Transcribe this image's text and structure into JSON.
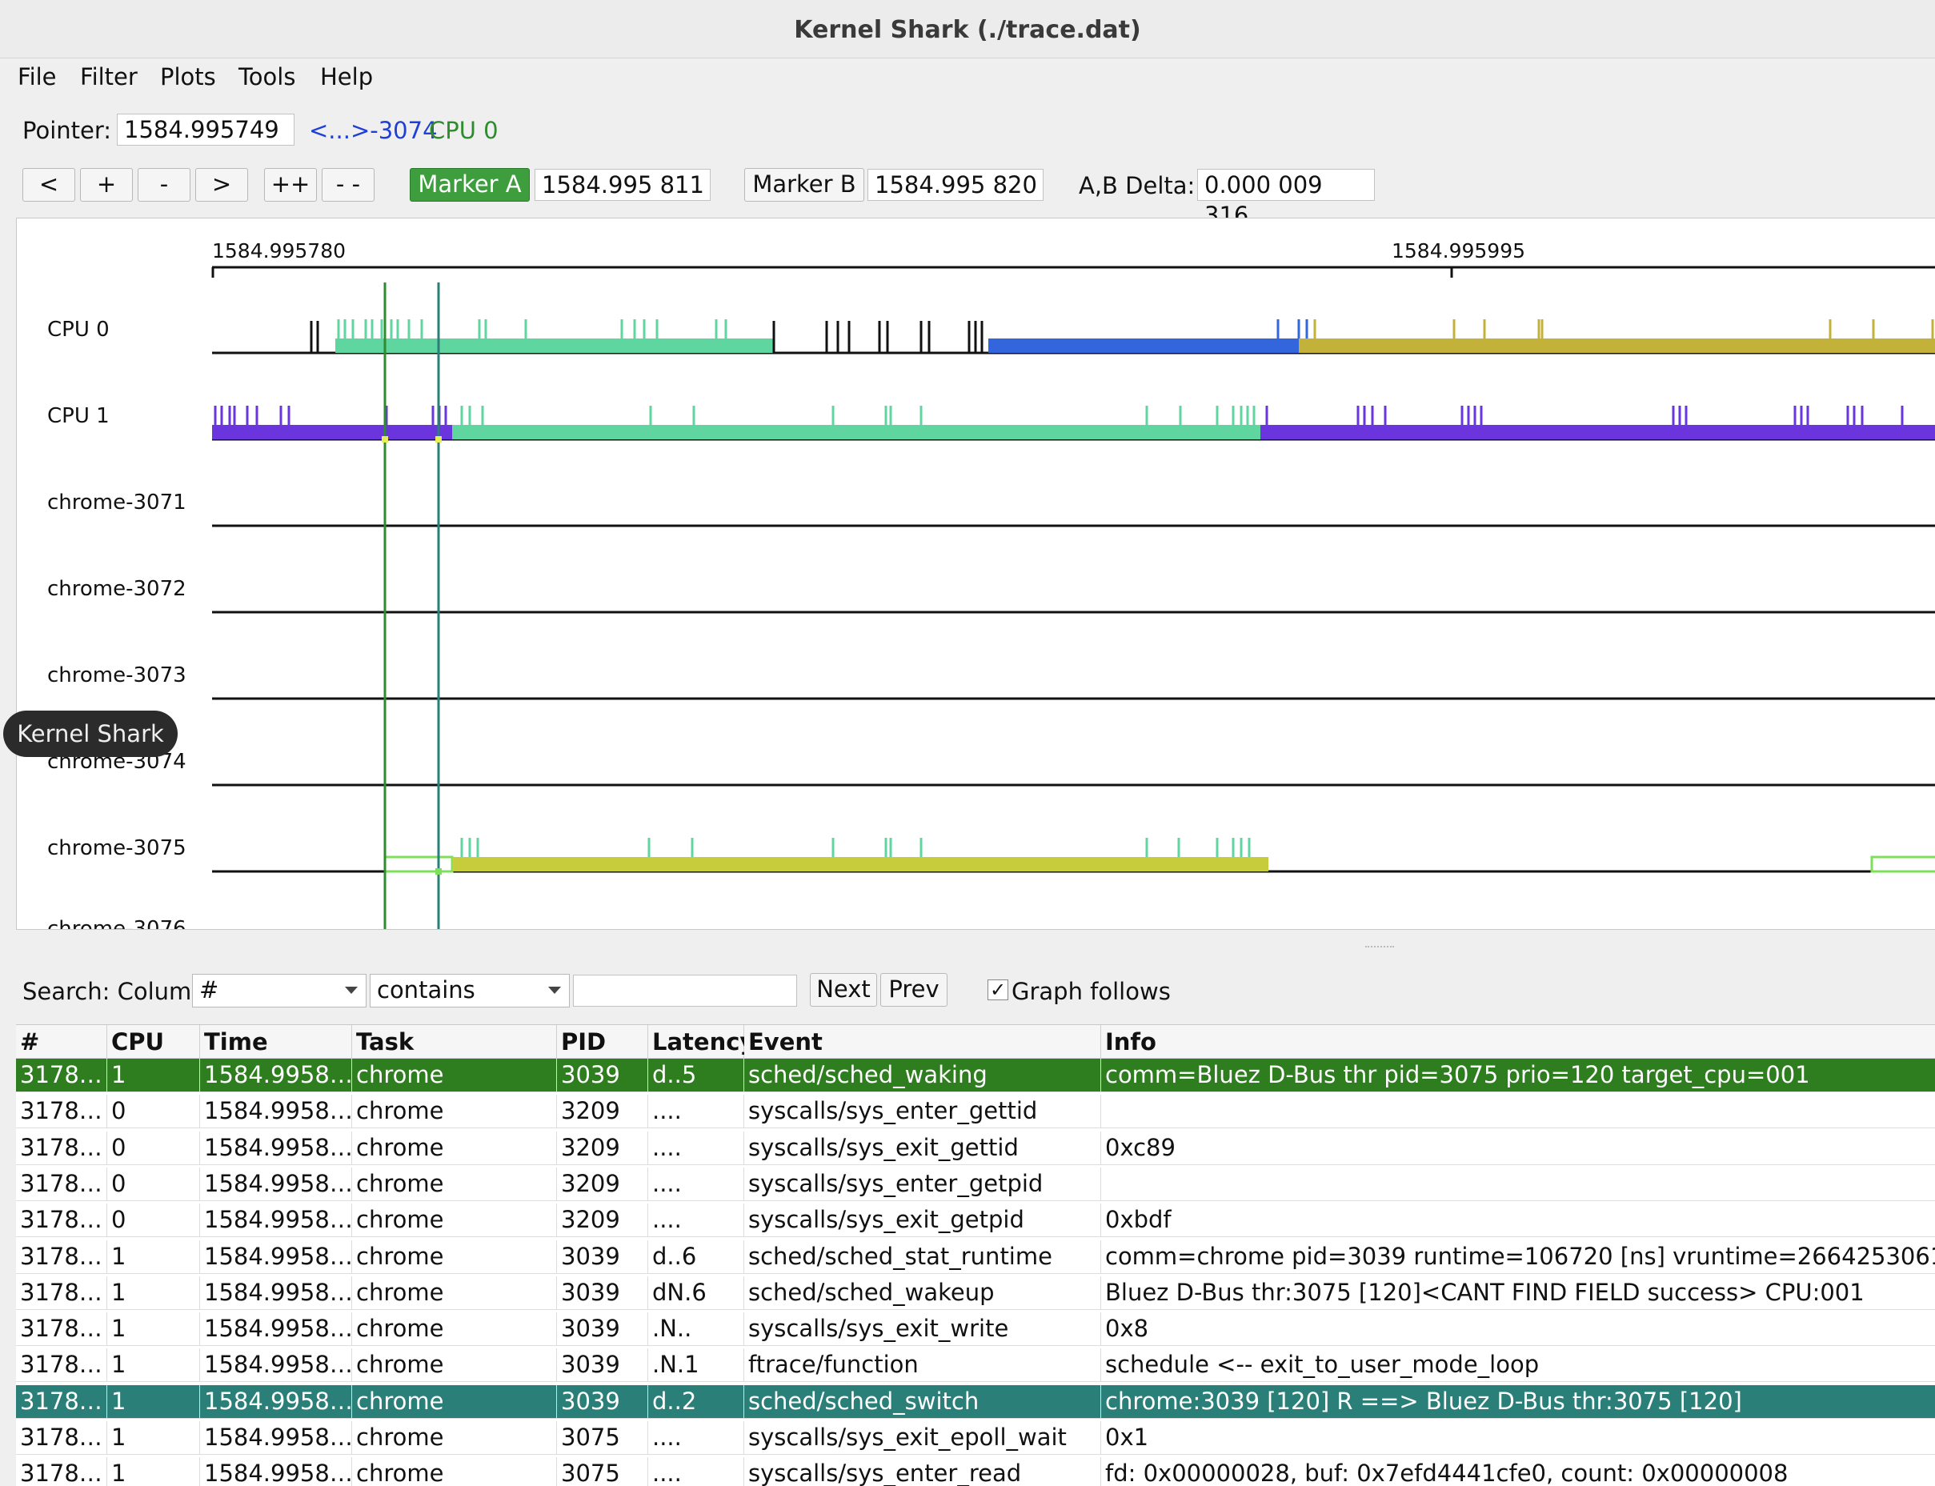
{
  "window": {
    "title": "Kernel Shark (./trace.dat)"
  },
  "menu": [
    "File",
    "Filter",
    "Plots",
    "Tools",
    "Help"
  ],
  "pointer": {
    "label": "Pointer:",
    "value": "1584.995749",
    "task": "<...>-3074",
    "cpu": "CPU 0"
  },
  "toolbar": {
    "buttons": [
      "<",
      "+",
      "-",
      ">",
      "++",
      "- -"
    ],
    "marker_a_label": "Marker A",
    "marker_a_value": "1584.995 811",
    "marker_b_label": "Marker B",
    "marker_b_value": "1584.995 820",
    "delta_label": "A,B Delta:",
    "delta_value": "0.000 009 316"
  },
  "graph": {
    "ticks": [
      "1584.995780",
      "1584.995995"
    ],
    "rows": [
      "CPU 0",
      "CPU 1",
      "chrome-3071",
      "chrome-3072",
      "chrome-3073",
      "chrome-3074",
      "chrome-3075"
    ],
    "colors": {
      "cpu0_green": "#5fd6a0",
      "cpu0_blue": "#3366dd",
      "cpu0_olive": "#c2b23a",
      "cpu1_purple": "#6a35dd",
      "task_lime": "#c6cc3c",
      "marker_a": "#2e8b2e",
      "marker_b": "#2a7f78"
    }
  },
  "tooltip": "Kernel Shark",
  "search": {
    "label": "Search: Column",
    "column": "#",
    "mode": "contains",
    "text": "",
    "next": "Next",
    "prev": "Prev",
    "graph_follows": "Graph follows",
    "graph_follows_checked": true
  },
  "table": {
    "columns": [
      "#",
      "CPU",
      "Time Stamp",
      "Task",
      "PID",
      "Latency",
      "Event",
      "Info"
    ],
    "rows": [
      [
        "3178…",
        "1",
        "1584.9958…",
        "chrome",
        "3039",
        "d..5",
        "sched/sched_waking",
        "comm=Bluez D-Bus thr pid=3075 prio=120 target_cpu=001"
      ],
      [
        "3178…",
        "0",
        "1584.9958…",
        "chrome",
        "3209",
        "....",
        "syscalls/sys_enter_gettid",
        ""
      ],
      [
        "3178…",
        "0",
        "1584.9958…",
        "chrome",
        "3209",
        "....",
        "syscalls/sys_exit_gettid",
        "0xc89"
      ],
      [
        "3178…",
        "0",
        "1584.9958…",
        "chrome",
        "3209",
        "....",
        "syscalls/sys_enter_getpid",
        ""
      ],
      [
        "3178…",
        "0",
        "1584.9958…",
        "chrome",
        "3209",
        "....",
        "syscalls/sys_exit_getpid",
        "0xbdf"
      ],
      [
        "3178…",
        "1",
        "1584.9958…",
        "chrome",
        "3039",
        "d..6",
        "sched/sched_stat_runtime",
        "comm=chrome pid=3039 runtime=106720 [ns] vruntime=26642530612 [ns]"
      ],
      [
        "3178…",
        "1",
        "1584.9958…",
        "chrome",
        "3039",
        "dN.6",
        "sched/sched_wakeup",
        "Bluez D-Bus thr:3075 [120]<CANT FIND FIELD success> CPU:001"
      ],
      [
        "3178…",
        "1",
        "1584.9958…",
        "chrome",
        "3039",
        ".N..",
        "syscalls/sys_exit_write",
        "0x8"
      ],
      [
        "3178…",
        "1",
        "1584.9958…",
        "chrome",
        "3039",
        ".N.1",
        "ftrace/function",
        "schedule <-- exit_to_user_mode_loop"
      ],
      [
        "3178…",
        "1",
        "1584.9958…",
        "chrome",
        "3039",
        "d..2",
        "sched/sched_switch",
        "chrome:3039 [120] R ==> Bluez D-Bus thr:3075 [120]"
      ],
      [
        "3178…",
        "1",
        "1584.9958…",
        "chrome",
        "3075",
        "....",
        "syscalls/sys_exit_epoll_wait",
        "0x1"
      ],
      [
        "3178…",
        "1",
        "1584.9958…",
        "chrome",
        "3075",
        "....",
        "syscalls/sys_enter_read",
        "fd: 0x00000028, buf: 0x7efd4441cfe0, count: 0x00000008"
      ],
      [
        "3178…",
        "0",
        "1584.9958…",
        "chrome",
        "3209",
        "....",
        "syscalls/sys_enter_gettid",
        ""
      ]
    ],
    "selected_rows": {
      "primary": 0,
      "secondary": 9
    }
  }
}
